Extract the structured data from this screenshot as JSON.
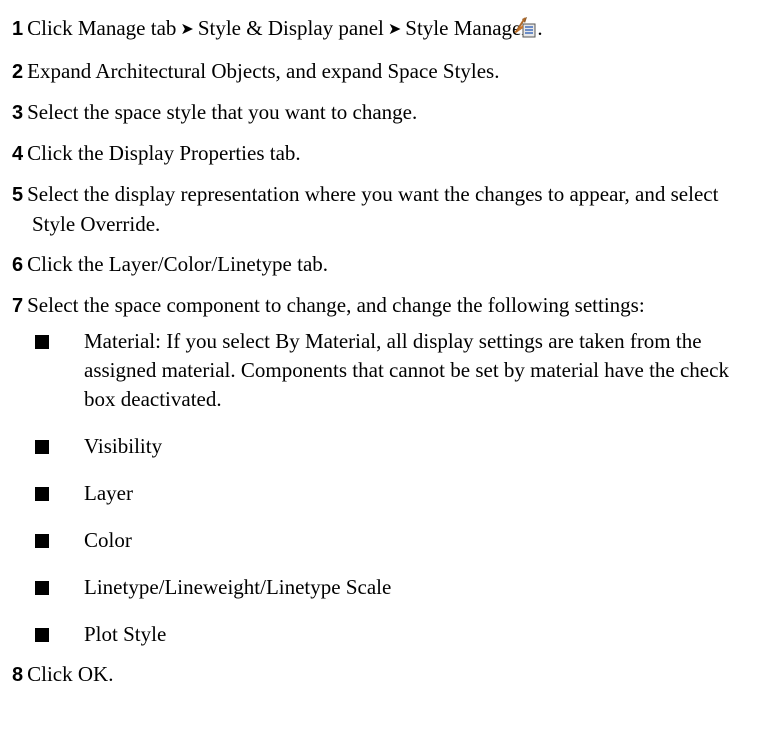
{
  "steps": [
    {
      "num": "1",
      "parts": [
        "Click Manage tab",
        "Style & Display panel",
        "Style Manager"
      ],
      "arrow": "➤",
      "icon": "style-manager-icon",
      "tail": "."
    },
    {
      "num": "2",
      "text": "Expand Architectural Objects, and expand Space Styles."
    },
    {
      "num": "3",
      "text": "Select the space style that you want to change."
    },
    {
      "num": "4",
      "text": "Click the Display Properties tab."
    },
    {
      "num": "5",
      "text": "Select the display representation where you want the changes to appear, and select Style Override."
    },
    {
      "num": "6",
      "text": "Click the Layer/Color/Linetype tab."
    },
    {
      "num": "7",
      "text": "Select the space component to change, and change the following settings:",
      "bullets": [
        "Material: If you select By Material, all display settings are taken from the assigned material. Components that cannot be set by material have the check box deactivated.",
        "Visibility",
        "Layer",
        "Color",
        "Linetype/Lineweight/Linetype Scale",
        "Plot Style"
      ]
    },
    {
      "num": "8",
      "text": "Click OK."
    }
  ]
}
